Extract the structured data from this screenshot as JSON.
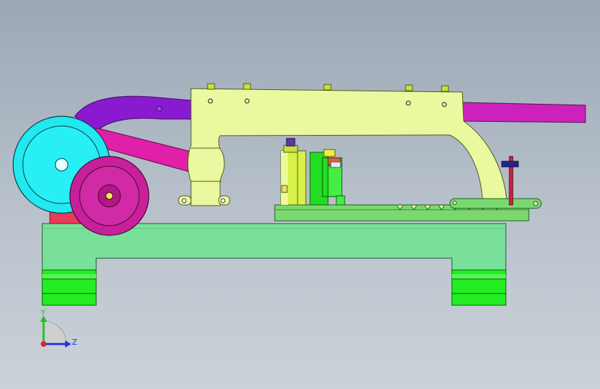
{
  "viewport": {
    "background_top": "#9aa7b5",
    "background_bottom": "#cbd1d8"
  },
  "triad": {
    "y_label": "Y",
    "z_label": "Z",
    "y_color": "#22c022",
    "z_color": "#2233dd",
    "x_color": "#dd2222"
  },
  "colors": {
    "base": "#78e09a",
    "feet": "#22ee22",
    "frame": "#eaf8a0",
    "cyan_pulley": "#22e8f0",
    "magenta_pulley": "#c8209a",
    "purple_link": "#8a1ad0",
    "pink_link": "#e020a8",
    "magenta_bar": "#cc22bb",
    "plate": "#7ad870",
    "cylinder_yellow": "#d8f04a",
    "green_block": "#22dd22",
    "red_rod": "#cc2244",
    "navy_bar": "#24248a"
  }
}
